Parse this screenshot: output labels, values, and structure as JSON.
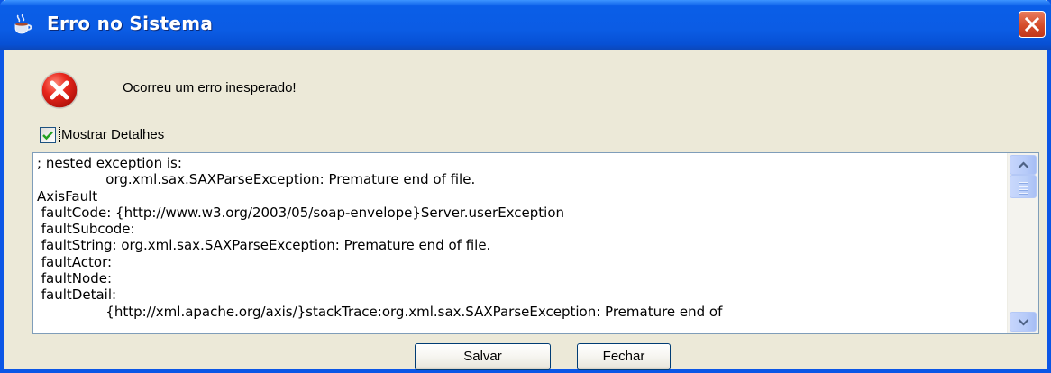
{
  "window": {
    "title": "Erro no Sistema",
    "title_icon": "java-coffee-cup-icon",
    "close_icon": "close-icon",
    "colors": {
      "titlebar": "#0b5ce4",
      "close_button": "#d54c2a",
      "window_background": "#ece9d8"
    }
  },
  "message": {
    "icon": "error-icon",
    "text": "Ocorreu um erro inesperado!"
  },
  "details_toggle": {
    "label": "Mostrar Detalhes",
    "checked": true
  },
  "details": {
    "lines": [
      "; nested exception is:",
      "                org.xml.sax.SAXParseException: Premature end of file.",
      "AxisFault",
      " faultCode: {http://www.w3.org/2003/05/soap-envelope}Server.userException",
      " faultSubcode:",
      " faultString: org.xml.sax.SAXParseException: Premature end of file.",
      " faultActor:",
      " faultNode:",
      " faultDetail:",
      "                {http://xml.apache.org/axis/}stackTrace:org.xml.sax.SAXParseException: Premature end of"
    ],
    "scrollbar": {
      "up_icon": "scroll-up-arrow-icon",
      "down_icon": "scroll-down-arrow-icon"
    }
  },
  "buttons": {
    "save_label": "Salvar",
    "close_label": "Fechar"
  }
}
